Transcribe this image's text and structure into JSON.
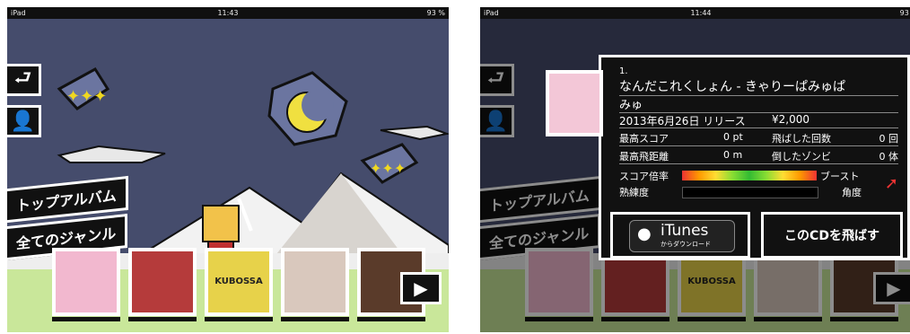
{
  "status_left": {
    "device": "iPad",
    "time": "11:43",
    "battery": "93 %"
  },
  "status_right": {
    "device": "iPad",
    "time": "11:44",
    "battery": "93 %"
  },
  "menu": {
    "top_album": "トップアルバム",
    "all_genres": "全てのジャンル"
  },
  "albums": [
    {
      "label": "",
      "color": "#f2b8cf"
    },
    {
      "label": "",
      "color": "#b53b3b"
    },
    {
      "label": "KUBOSSA",
      "color": "#e7d24a"
    },
    {
      "label": "",
      "color": "#d9c8bd"
    },
    {
      "label": "",
      "color": "#5a3b2a"
    }
  ],
  "info": {
    "index": "1.",
    "title": "なんだこれくしょん - きゃりーぱみゅぱ",
    "artist": "みゅ",
    "release": "2013年6月26日 リリース",
    "price": "¥2,000",
    "best_score_label": "最高スコア",
    "best_score_value": "0 pt",
    "flights_label": "飛ばした回数",
    "flights_value": "0 回",
    "best_distance_label": "最高飛距離",
    "best_distance_value": "0 m",
    "zombies_label": "倒したゾンビ",
    "zombies_value": "0 体",
    "score_multiplier_label": "スコア倍率",
    "proficiency_label": "熟練度",
    "boost_label": "ブースト",
    "angle_label": "角度"
  },
  "buttons": {
    "itunes_main": "iTunes",
    "itunes_sub": "からダウンロード",
    "fly_cd": "このCDを飛ばす"
  },
  "colors": {
    "sky": "#454c6c",
    "ground": "#c9e79a",
    "accent": "#f0c020"
  }
}
